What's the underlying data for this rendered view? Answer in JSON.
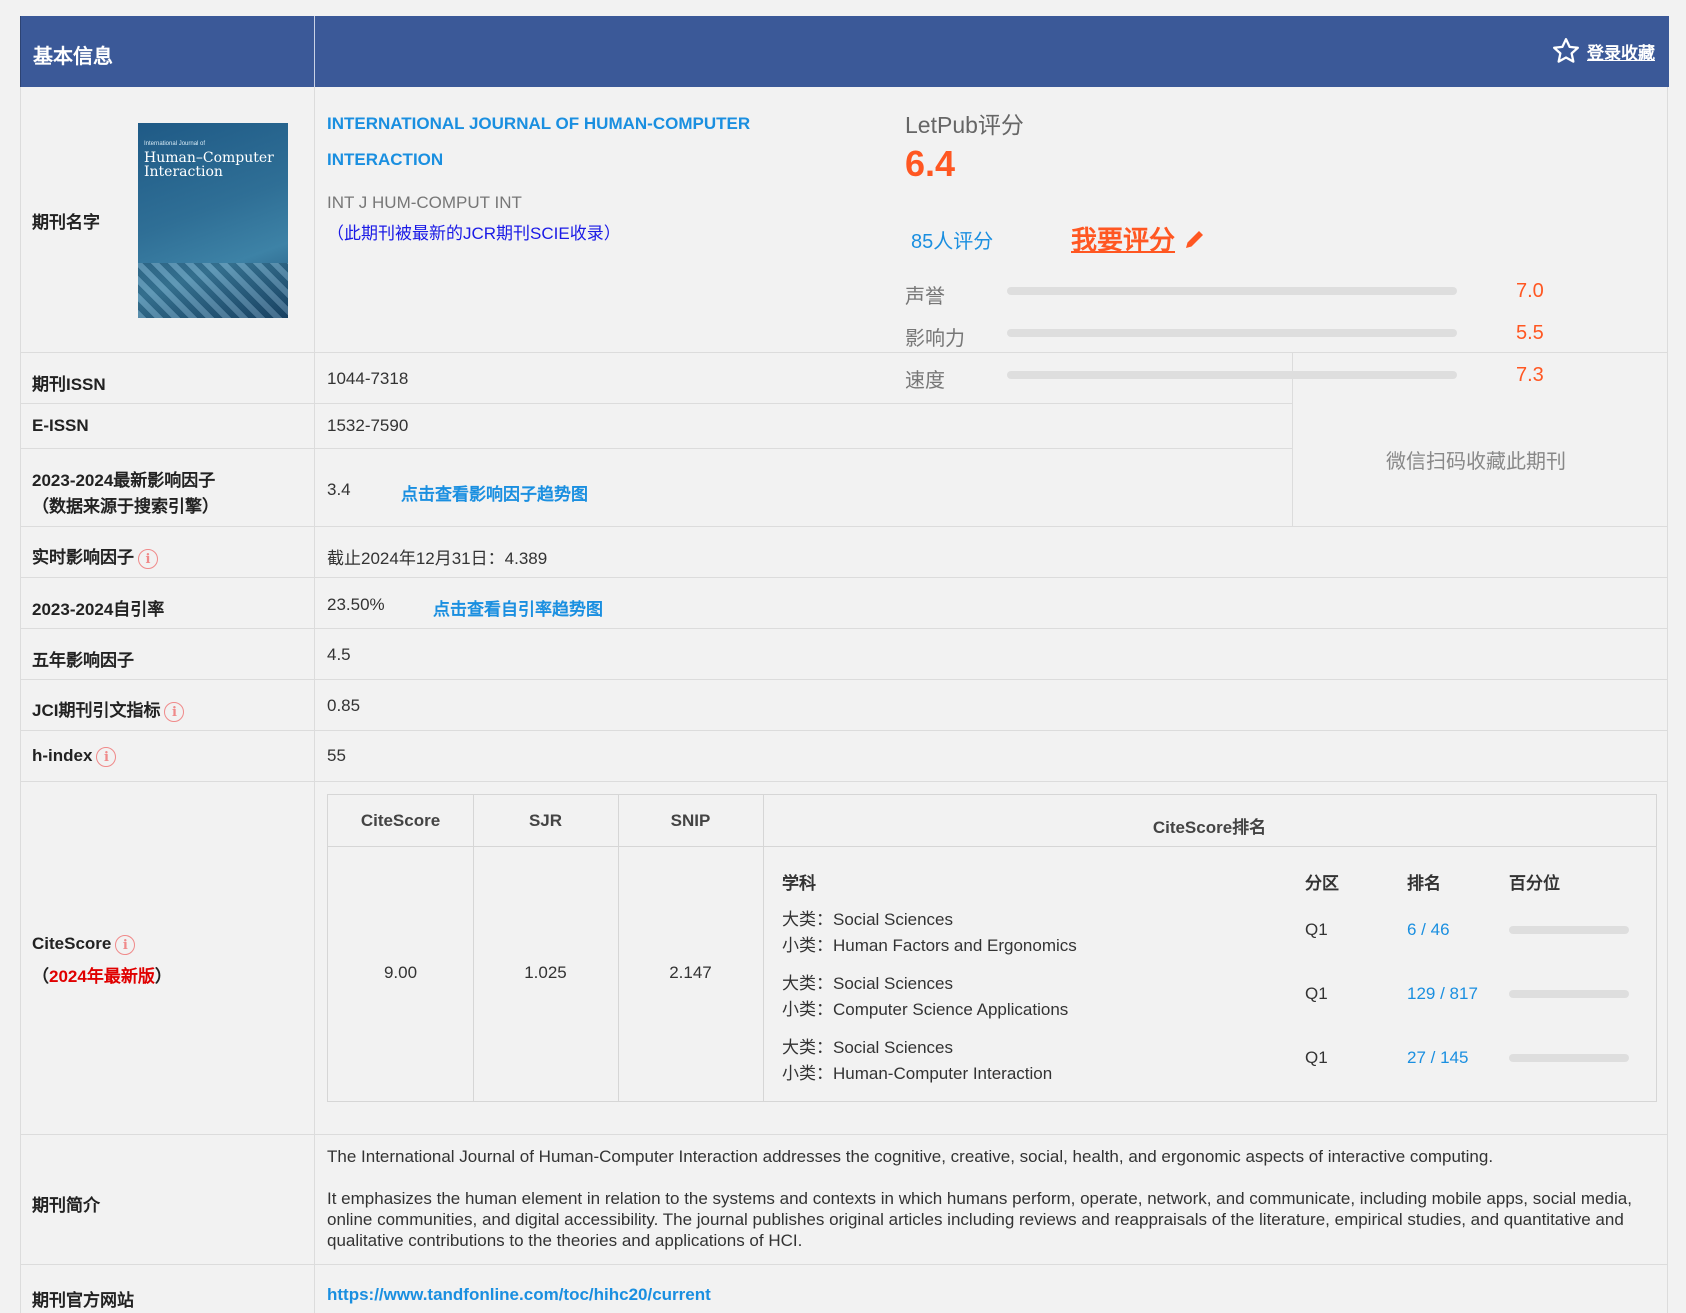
{
  "header": {
    "title": "基本信息",
    "favorite_label": "登录收藏"
  },
  "journal": {
    "label": "期刊名字",
    "cover_title_small": "International Journal of",
    "cover_title_main": "Human–Computer Interaction",
    "name_line1": "INTERNATIONAL JOURNAL OF HUMAN-COMPUTER",
    "name_line2": "INTERACTION",
    "abbr": "INT J HUM-COMPUT INT",
    "note": "（此期刊被最新的JCR期刊SCIE收录）"
  },
  "rating": {
    "title": "LetPub评分",
    "score": "6.4",
    "count": "85人评分",
    "rate_link": "我要评分",
    "items": [
      {
        "label": "声誉",
        "value": "7.0",
        "score": 7.0
      },
      {
        "label": "影响力",
        "value": "5.5",
        "score": 5.5
      },
      {
        "label": "速度",
        "value": "7.3",
        "score": 7.3
      }
    ]
  },
  "wechat": "微信扫码收藏此期刊",
  "rows": {
    "issn": {
      "label": "期刊ISSN",
      "value": "1044-7318"
    },
    "eissn": {
      "label": "E-ISSN",
      "value": "1532-7590"
    },
    "if": {
      "label1": "2023-2024最新影响因子",
      "label2": "（数据来源于搜索引擎）",
      "value": "3.4",
      "link": "点击查看影响因子趋势图"
    },
    "realtime_if": {
      "label": "实时影响因子",
      "value": "截止2024年12月31日：4.389"
    },
    "self_cite": {
      "label": "2023-2024自引率",
      "value": "23.50%",
      "link": "点击查看自引率趋势图"
    },
    "five_year_if": {
      "label": "五年影响因子",
      "value": "4.5"
    },
    "jci": {
      "label": "JCI期刊引文指标",
      "value": "0.85"
    },
    "hindex": {
      "label": "h-index",
      "value": "55"
    }
  },
  "citescore": {
    "label": "CiteScore",
    "label_paren_open": "（",
    "label_edition": "2024年最新版",
    "label_paren_close": "）",
    "headers": {
      "citescore": "CiteScore",
      "sjr": "SJR",
      "snip": "SNIP",
      "ranking": "CiteScore排名"
    },
    "values": {
      "citescore": "9.00",
      "sjr": "1.025",
      "snip": "2.147"
    },
    "rank_headers": {
      "subject": "学科",
      "quartile": "分区",
      "rank": "排名",
      "percentile": "百分位"
    },
    "ranks": [
      {
        "major": "大类：Social Sciences",
        "minor": "小类：Human Factors and Ergonomics",
        "quartile": "Q1",
        "rank": "6 / 46"
      },
      {
        "major": "大类：Social Sciences",
        "minor": "小类：Computer Science Applications",
        "quartile": "Q1",
        "rank": "129 / 817"
      },
      {
        "major": "大类：Social Sciences",
        "minor": "小类：Human-Computer Interaction",
        "quartile": "Q1",
        "rank": "27 / 145"
      }
    ]
  },
  "intro": {
    "label": "期刊简介",
    "p1": "The International Journal of Human-Computer Interaction addresses the cognitive, creative, social, health, and ergonomic aspects of interactive computing.",
    "p2": "It emphasizes the human element in relation to the systems and contexts in which humans perform, operate, network, and communicate, including mobile apps, social media, online communities, and digital accessibility. The journal publishes original articles including reviews and reappraisals of the literature, empirical studies, and quantitative and qualitative contributions to the theories and applications of HCI."
  },
  "website": {
    "label": "期刊官方网站",
    "url": "https://www.tandfonline.com/toc/hihc20/current"
  },
  "colors": {
    "header": "#3b5998",
    "accent": "#ff5722",
    "link": "#1a8fe0"
  }
}
